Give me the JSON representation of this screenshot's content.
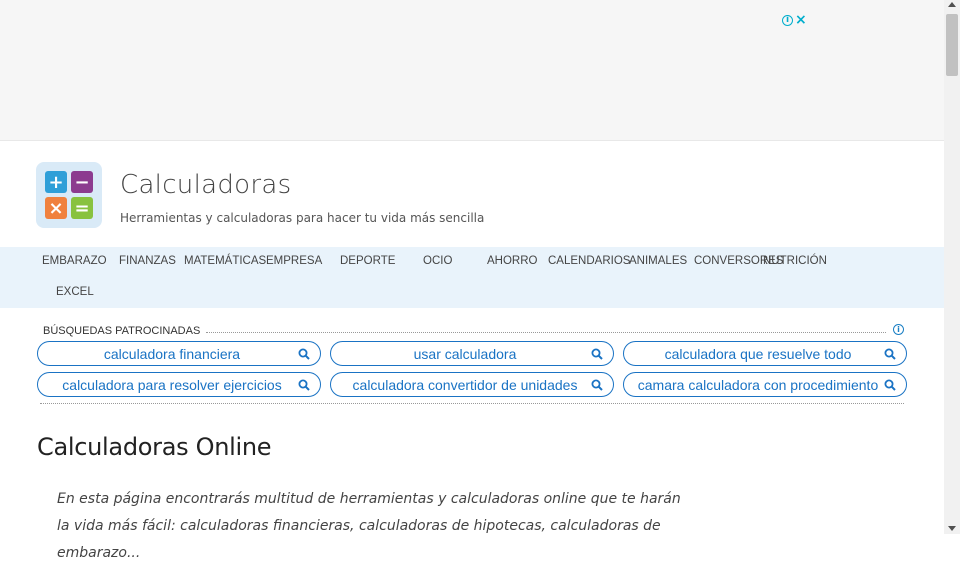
{
  "ad": {
    "info_icon": "info-icon",
    "close_icon": "close-icon"
  },
  "header": {
    "title": "Calculadoras",
    "tagline": "Herramientas y calculadoras para hacer tu vida más sencilla",
    "logo_symbols": [
      "+",
      "−",
      "×",
      "="
    ]
  },
  "nav": {
    "items": [
      "EMBARAZO",
      "FINANZAS",
      "MATEMÁTICAS",
      "EMPRESA",
      "DEPORTE",
      "OCIO",
      "AHORRO",
      "CALENDARIOS",
      "ANIMALES",
      "CONVERSORES",
      "NUTRICIÓN",
      "EXCEL"
    ]
  },
  "sponsored": {
    "label": "BÚSQUEDAS PATROCINADAS",
    "searches": [
      "calculadora financiera",
      "usar calculadora",
      "calculadora que resuelve todo",
      "calculadora para resolver ejercicios",
      "calculadora convertidor de unidades",
      "camara calculadora con procedimiento"
    ]
  },
  "main": {
    "title": "Calculadoras Online",
    "intro": "En esta página encontrarás multitud de herramientas y calculadoras online que te harán la vida más fácil: calculadoras financieras, calculadoras de hipotecas, calculadoras de embarazo..."
  },
  "colors": {
    "accent": "#1a73c4",
    "nav_bg": "#e9f3fb",
    "logo_bg": "#d9eaf7"
  }
}
